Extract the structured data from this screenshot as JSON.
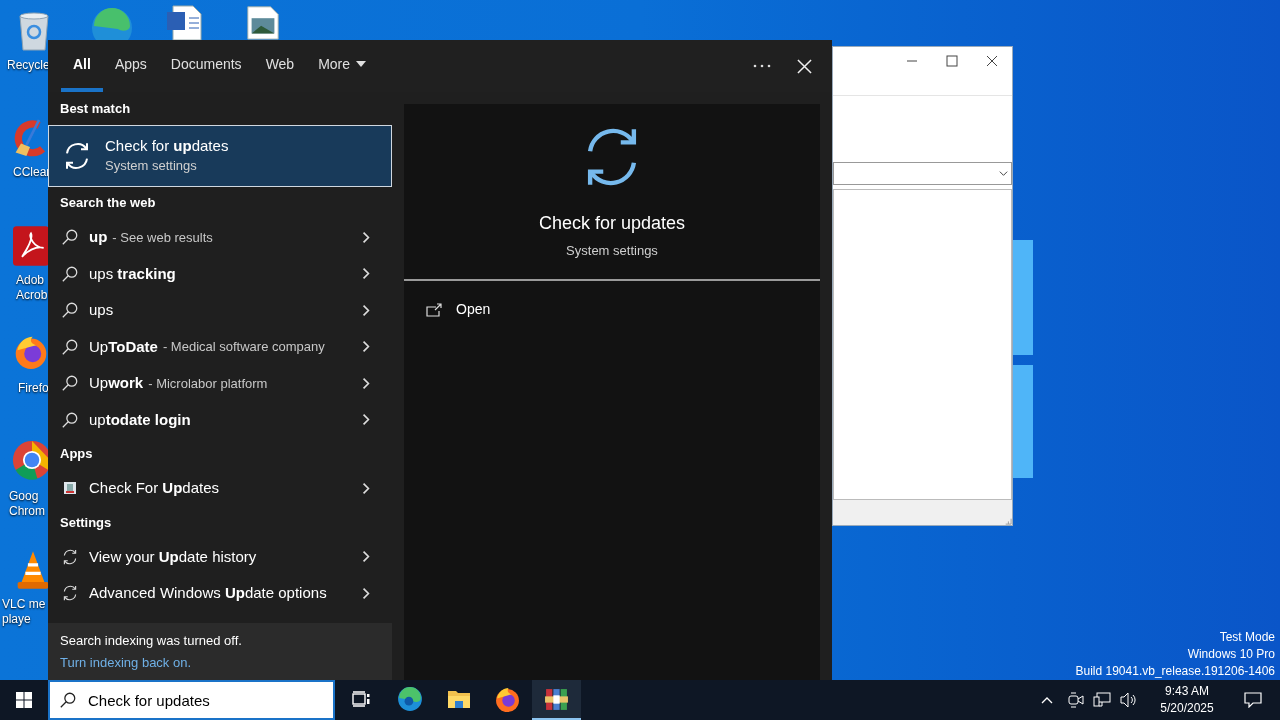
{
  "desktop": {
    "icons": [
      {
        "kind": "bin",
        "label_lines": [
          "Recycle"
        ]
      },
      {
        "kind": "browser"
      },
      {
        "kind": "word"
      },
      {
        "kind": "image"
      },
      {
        "kind": "broom",
        "label_lines": [
          "CClear"
        ]
      },
      {
        "kind": "pdf",
        "label_lines": [
          "Adob",
          "Acrob"
        ]
      },
      {
        "kind": "firefox",
        "label_lines": [
          "Firefo"
        ]
      },
      {
        "kind": "chrome",
        "label_lines": [
          "Goog",
          "Chrom"
        ]
      },
      {
        "kind": "cone",
        "label_lines": [
          "VLC me",
          "playe"
        ]
      }
    ],
    "system_text": [
      "Test Mode",
      "Windows 10 Pro",
      "Build 19041.vb_release.191206-1406"
    ]
  },
  "search_panel": {
    "tabs": [
      {
        "label": "All",
        "selected": true
      },
      {
        "label": "Apps",
        "selected": false
      },
      {
        "label": "Documents",
        "selected": false
      },
      {
        "label": "Web",
        "selected": false
      }
    ],
    "more": {
      "label": "More"
    },
    "sections": [
      {
        "heading": "Best match",
        "items": [
          {
            "kind": "best",
            "title": "Check for **up**dates",
            "subtitle": "System settings",
            "selected": true
          }
        ]
      },
      {
        "heading": "Search the web",
        "items": [
          {
            "kind": "web",
            "title": "**up**",
            "description": "- See web results",
            "selected": false
          },
          {
            "kind": "web",
            "title": "ups **tracking**",
            "selected": false
          },
          {
            "kind": "web",
            "title": "ups",
            "selected": false
          },
          {
            "kind": "web",
            "title": "Up**ToDate**",
            "description": "- Medical software company",
            "selected": false
          },
          {
            "kind": "web",
            "title": "Up**work**",
            "description": "- Microlabor platform",
            "selected": false
          },
          {
            "kind": "web",
            "title": "up**todate login**",
            "selected": false
          }
        ]
      },
      {
        "heading": "Apps",
        "items": [
          {
            "kind": "app",
            "title": "Check For **Up**dates",
            "selected": false
          }
        ]
      },
      {
        "heading": "Settings",
        "items": [
          {
            "kind": "setting",
            "title": "View your **Up**date history",
            "selected": false
          },
          {
            "kind": "setting",
            "title": "Advanced Windows **Up**date options",
            "selected": false
          }
        ]
      }
    ],
    "notice": {
      "text": "Search indexing was turned off.",
      "link": "Turn indexing back on."
    },
    "preview": {
      "title": "Check for updates",
      "subtitle": "System settings",
      "actions": [
        {
          "label": "Open"
        }
      ]
    }
  },
  "taskbar": {
    "search": {
      "value": "Check for updates"
    },
    "apps": [
      {
        "kind": "taskview",
        "selected": false
      },
      {
        "kind": "edge",
        "selected": false
      },
      {
        "kind": "folder",
        "selected": false
      },
      {
        "kind": "firefox",
        "selected": false
      },
      {
        "kind": "archive",
        "selected": true
      }
    ],
    "clock": {
      "time": "9:43 AM",
      "date": "5/20/2025"
    }
  }
}
